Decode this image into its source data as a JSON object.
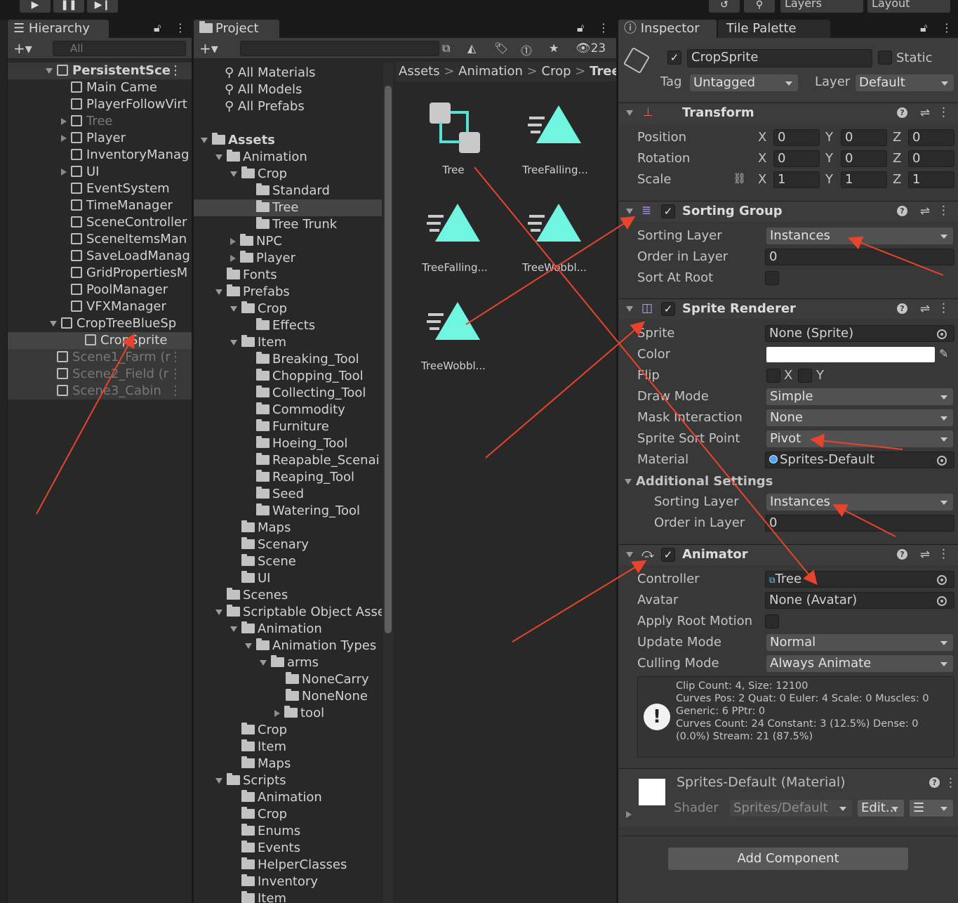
{
  "toolbar": {
    "layers": "Layers",
    "layout": "Layout"
  },
  "hierarchy": {
    "tab": "Hierarchy",
    "search": "All",
    "items": [
      {
        "label": "PersistentSce",
        "type": "scene",
        "bold": true
      },
      {
        "label": "Main Came",
        "type": "obj"
      },
      {
        "label": "PlayerFollowVirt",
        "type": "obj"
      },
      {
        "label": "Tree",
        "type": "obj",
        "dim": true
      },
      {
        "label": "Player",
        "type": "obj"
      },
      {
        "label": "InventoryManag",
        "type": "obj"
      },
      {
        "label": "UI",
        "type": "obj"
      },
      {
        "label": "EventSystem",
        "type": "obj"
      },
      {
        "label": "TimeManager",
        "type": "obj"
      },
      {
        "label": "SceneController",
        "type": "obj"
      },
      {
        "label": "SceneItemsMan",
        "type": "obj"
      },
      {
        "label": "SaveLoadManag",
        "type": "obj"
      },
      {
        "label": "GridPropertiesM",
        "type": "obj"
      },
      {
        "label": "PoolManager",
        "type": "obj"
      },
      {
        "label": "VFXManager",
        "type": "obj"
      },
      {
        "label": "CropTreeBlueSp",
        "type": "obj"
      },
      {
        "label": "CropSprite",
        "type": "obj",
        "selected": true
      },
      {
        "label": "Scene1_Farm (r",
        "type": "scene",
        "dim": true
      },
      {
        "label": "Scene2_Field (r",
        "type": "scene",
        "dim": true
      },
      {
        "label": "Scene3_Cabin",
        "type": "scene",
        "dim": true
      }
    ]
  },
  "project": {
    "tab": "Project",
    "count": "23",
    "favorites": [
      "All Materials",
      "All Models",
      "All Prefabs"
    ],
    "tree": [
      "Assets",
      "Animation",
      "Crop",
      "Standard",
      "Tree",
      "Tree Trunk",
      "NPC",
      "Player",
      "Fonts",
      "Prefabs",
      "Crop",
      "Effects",
      "Item",
      "Breaking_Tool",
      "Chopping_Tool",
      "Collecting_Tool",
      "Commodity",
      "Furniture",
      "Hoeing_Tool",
      "Reapable_Scenai",
      "Reaping_Tool",
      "Seed",
      "Watering_Tool",
      "Maps",
      "Scenary",
      "Scene",
      "UI",
      "Scenes",
      "Scriptable Object Asse",
      "Animation",
      "Animation Types",
      "arms",
      "NoneCarry",
      "NoneNone",
      "tool",
      "Crop",
      "Item",
      "Maps",
      "Scripts",
      "Animation",
      "Crop",
      "Enums",
      "Events",
      "HelperClasses",
      "Inventory",
      "Item"
    ],
    "breadcrumb": [
      "Assets",
      "Animation",
      "Crop",
      "Tree"
    ],
    "assets": [
      "Tree",
      "TreeFalling...",
      "TreeFalling...",
      "TreeWobbl...",
      "TreeWobbl..."
    ]
  },
  "inspector": {
    "tab": "Inspector",
    "tab2": "Tile Palette",
    "object_name": "CropSprite",
    "static": "Static",
    "tag_label": "Tag",
    "tag": "Untagged",
    "layer_label": "Layer",
    "layer": "Default",
    "transform": {
      "title": "Transform",
      "position": "Position",
      "rotation": "Rotation",
      "scale": "Scale",
      "x": "X",
      "y": "Y",
      "z": "Z",
      "pos": [
        "0",
        "0",
        "0"
      ],
      "rot": [
        "0",
        "0",
        "0"
      ],
      "scl": [
        "1",
        "1",
        "1"
      ]
    },
    "sorting_group": {
      "title": "Sorting Group",
      "sorting_layer": "Sorting Layer",
      "sorting_layer_value": "Instances",
      "order": "Order in Layer",
      "order_value": "0",
      "sort_at_root": "Sort At Root"
    },
    "sprite_renderer": {
      "title": "Sprite Renderer",
      "sprite": "Sprite",
      "sprite_value": "None (Sprite)",
      "color": "Color",
      "flip": "Flip",
      "fx": "X",
      "fy": "Y",
      "draw_mode": "Draw Mode",
      "draw_mode_value": "Simple",
      "mask": "Mask Interaction",
      "mask_value": "None",
      "sort_point": "Sprite Sort Point",
      "sort_point_value": "Pivot",
      "material": "Material",
      "material_value": "Sprites-Default",
      "additional": "Additional Settings",
      "sorting_layer": "Sorting Layer",
      "sorting_layer_value": "Instances",
      "order": "Order in Layer",
      "order_value": "0"
    },
    "animator": {
      "title": "Animator",
      "controller": "Controller",
      "controller_value": "Tree",
      "avatar": "Avatar",
      "avatar_value": "None (Avatar)",
      "root_motion": "Apply Root Motion",
      "update": "Update Mode",
      "update_value": "Normal",
      "culling": "Culling Mode",
      "culling_value": "Always Animate",
      "info": [
        "Clip Count: 4, Size: 12100",
        "Curves Pos: 2 Quat: 0 Euler: 4 Scale: 0 Muscles: 0",
        "Generic: 6 PPtr: 0",
        "Curves Count: 24 Constant: 3 (12.5%) Dense: 0",
        "(0.0%) Stream: 21 (87.5%)"
      ]
    },
    "material": {
      "title": "Sprites-Default (Material)",
      "shader": "Shader",
      "shader_value": "Sprites/Default",
      "edit": "Edit..."
    },
    "add_component": "Add Component"
  }
}
